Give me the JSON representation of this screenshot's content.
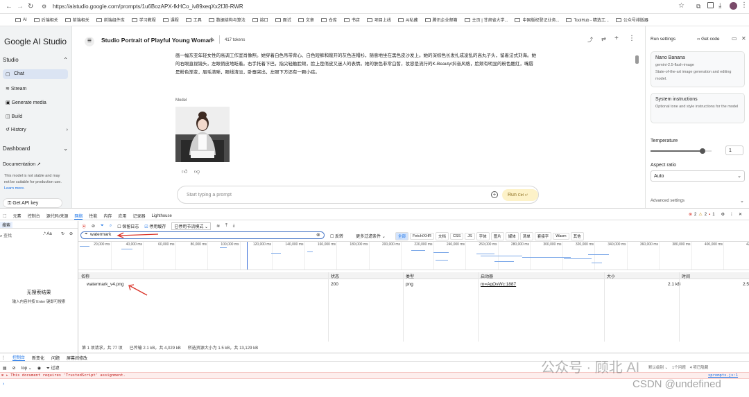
{
  "browser": {
    "url": "https://aistudio.google.com/prompts/1u6BozAPX-fkHCo_iv89xeqXx2fJ8-RWR",
    "bookmarks": [
      "AI",
      "后端相关",
      "前端相关",
      "前端组件库",
      "学习教程",
      "课程",
      "工具",
      "数据结构与算法",
      "接口",
      "面试",
      "文章",
      "仓库",
      "书店",
      "项目上线",
      "AI私藏",
      "腾讯企业邮箱",
      "主页 | 甘肃省大学...",
      "中国版权登记业务...",
      "ToolHub - 精选工...",
      "公众号排版器"
    ]
  },
  "sidebar": {
    "logo": "Google AI Studio",
    "studio_label": "Studio",
    "items": [
      "Chat",
      "Stream",
      "Generate media",
      "Build",
      "History"
    ],
    "dashboard": "Dashboard",
    "documentation": "Documentation",
    "notice": "This model is not stable and may not be suitable for production use.",
    "learn_more": "Learn more.",
    "get_api_key": "Get API key"
  },
  "main": {
    "title": "Studio Portrait of Playful Young Woman",
    "tokens": "417 tokens",
    "prompt_text": "画一幅东亚年轻女性的高调工作室肖像照。她穿着白色吊带背心、白色短裤和敞开的灰色连帽衫，随意地坐在黑色皮沙发上。她的深棕色长发扎成凌乱的高丸子头，留着法式刘海。她的右眼直视镜头，左眼俏皮地眨着。右手托着下巴，指尖轻触脸颊，脸上是俏皮又迷人的表情。她的肤色非常白皙，妆容是流行的K-Beauty/抖音风格，脸颊有明显的粉色腮红，嘴唇是粉色渐变，眉毛清晰，眼线清淡，卧蚕突出，左眼下方还有一颗小痣。",
    "model_label": "Model",
    "input_placeholder": "Start typing a prompt",
    "run_label": "Run",
    "run_shortcut": "Ctrl ↵"
  },
  "right": {
    "header": "Run settings",
    "get_code": "Get code",
    "model_name": "Nano Banana",
    "model_id": "gemini-2.5-flash-image",
    "model_desc": "State-of-the-art image generation and editing model.",
    "sys_title": "System instructions",
    "sys_desc": "Optional tone and style instructions for the model",
    "temperature_label": "Temperature",
    "temperature_value": "1",
    "temperature_level": 0.85,
    "aspect_label": "Aspect ratio",
    "aspect_value": "Auto",
    "advanced": "Advanced settings"
  },
  "devtools": {
    "tabs": [
      "元素",
      "控制台",
      "源代码/来源",
      "网络",
      "性能",
      "内存",
      "应用",
      "记录器",
      "Lighthouse"
    ],
    "active_tab": "网络",
    "errors": "2",
    "warnings": "2",
    "issues": "1",
    "search_tab": "搜索",
    "search_placeholder": "查找",
    "no_results": "无搜索结果",
    "no_results_hint": "输入内容并按 Enter 键即可搜索",
    "toolbar": {
      "preserve_log": "保留日志",
      "disable_cache": "停用缓存",
      "throttle": "已停用节流模式"
    },
    "filter_value": "watermark",
    "invert": "反转",
    "more_filters": "更多过滤条件",
    "type_filters": [
      "全部",
      "Fetch/XHR",
      "文档",
      "CSS",
      "JS",
      "字体",
      "图片",
      "媒体",
      "清单",
      "套接字",
      "Wasm",
      "其他"
    ],
    "timeline_ticks": [
      "20,000 ms",
      "40,000 ms",
      "60,000 ms",
      "80,000 ms",
      "100,000 ms",
      "120,000 ms",
      "140,000 ms",
      "160,000 ms",
      "180,000 ms",
      "200,000 ms",
      "220,000 ms",
      "240,000 ms",
      "260,000 ms",
      "280,000 ms",
      "300,000 ms",
      "320,000 ms",
      "340,000 ms",
      "360,000 ms",
      "380,000 ms",
      "400,000 ms",
      "420,0"
    ],
    "columns": [
      "名称",
      "状态",
      "类型",
      "启动器",
      "大小",
      "时间"
    ],
    "rows": [
      {
        "name": "watermark_v4.png",
        "status": "200",
        "type": "png",
        "initiator": "m=AgOvWc:1887",
        "size": "2.1 kB",
        "time": "2.59"
      }
    ],
    "status_bar": [
      "第 1 项请求，共 77 项",
      "已传输 2.1 kB，共 4,029 kB",
      "所选资源大小为 1.5 kB，共 13,129 kB"
    ],
    "drawer_tabs": [
      "控制台",
      "新变化",
      "问题",
      "屏幕间修改"
    ],
    "console_top": "top",
    "console_filter": "过滤",
    "console_msg": "This document requires 'TrustedScript' assignment.",
    "console_src": "sprompts.js:1",
    "default_levels": "默认级别",
    "issues_count": "1个问题",
    "hidden": "4 项已隐藏"
  },
  "watermark": {
    "wechat": "公众号 · 顾北 AI",
    "csdn": "CSDN @undefined"
  },
  "colors": {
    "accent": "#1a73e8",
    "filter_border": "#4a78c8",
    "annotation_red": "#d93025",
    "run_bg": "#fdf2c8"
  }
}
